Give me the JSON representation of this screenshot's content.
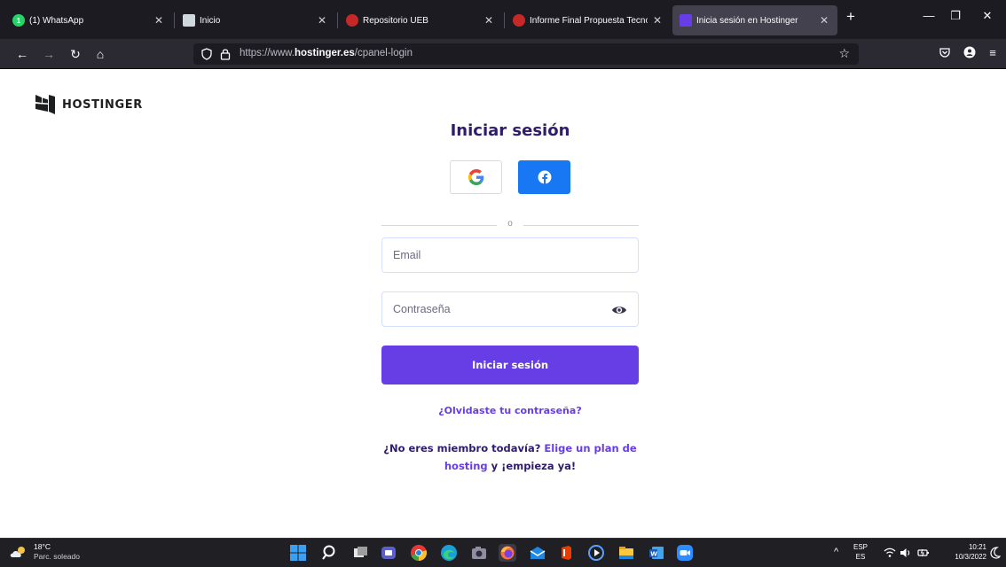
{
  "browser": {
    "tabs": [
      {
        "title": "(1) WhatsApp",
        "active": false
      },
      {
        "title": "Inicio",
        "active": false
      },
      {
        "title": "Repositorio UEB",
        "active": false
      },
      {
        "title": "Informe Final Propuesta Tecnoló",
        "active": false
      },
      {
        "title": "Inicia sesión en Hostinger",
        "active": true
      }
    ],
    "url_prefix": "https://www.",
    "url_domain": "hostinger.es",
    "url_path": "/cpanel-login"
  },
  "page": {
    "logo_text": "HOSTINGER",
    "title": "Iniciar sesión",
    "divider_text": "o",
    "email_placeholder": "Email",
    "password_placeholder": "Contraseña",
    "login_button": "Iniciar sesión",
    "forgot_password": "¿Olvidaste tu contraseña?",
    "signup_prefix": "¿No eres miembro todavía?",
    "signup_link": "Elige un plan de hosting",
    "signup_suffix": "y ¡empieza ya!"
  },
  "taskbar": {
    "weather_temp": "18°C",
    "weather_desc": "Parc. soleado",
    "lang_top": "ESP",
    "lang_bottom": "ES",
    "time": "10:21",
    "date": "10/3/2022"
  },
  "colors": {
    "brand_primary": "#673de6",
    "brand_dark": "#2f1c6a",
    "facebook": "#1877f2"
  }
}
